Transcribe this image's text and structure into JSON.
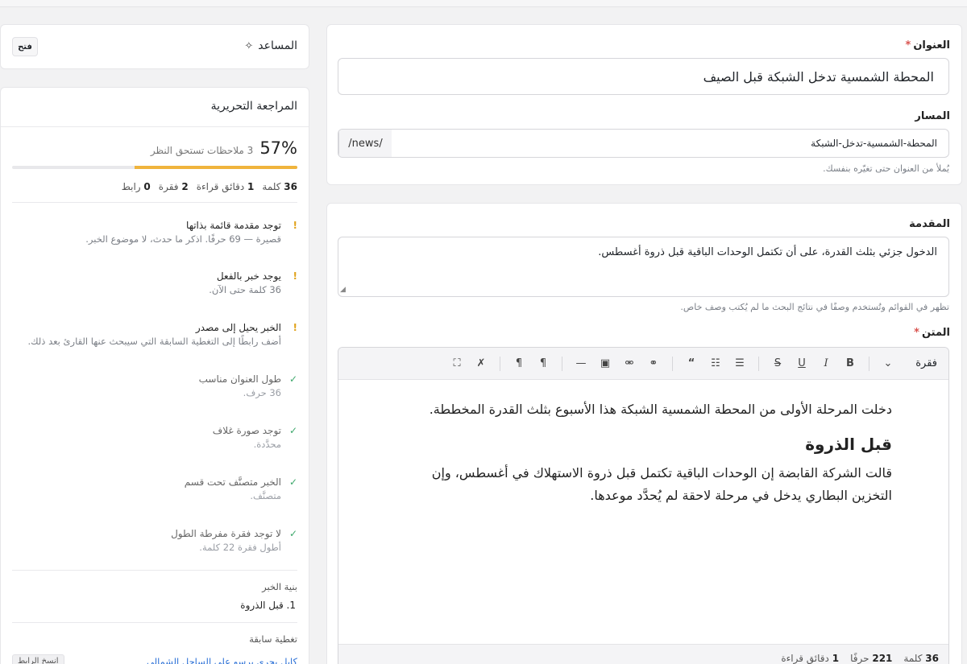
{
  "form": {
    "title_label": "العنوان",
    "title_required": "*",
    "title_value": "المحطة الشمسية تدخل الشبكة قبل الصيف",
    "slug_label": "المسار",
    "slug_prefix": "/news/",
    "slug_value": "المحطة-الشمسية-تدخل-الشبكة",
    "slug_hint": "يُملأ من العنوان حتى تغيّره بنفسك.",
    "lead_label": "المقدمة",
    "lead_value": "الدخول جزئي بثلث القدرة، على أن تكتمل الوحدات الباقية قبل ذروة أغسطس.",
    "lead_hint": "تظهر في القوائم وتُستخدم وصفًا في نتائج البحث ما لم يُكتب وصف خاص.",
    "body_label": "المتن",
    "body_required": "*"
  },
  "editor": {
    "block_type": "فقرة",
    "paragraph_1": "دخلت المرحلة الأولى من المحطة الشمسية الشبكة هذا الأسبوع بثلث القدرة المخططة.",
    "heading": "قبل الذروة",
    "paragraph_2": "قالت الشركة القابضة إن الوحدات الباقية تكتمل قبل ذروة الاستهلاك في أغسطس، وإن التخزين البطاري يدخل في مرحلة لاحقة لم يُحدَّد موعدها.",
    "footer": {
      "words_num": "36",
      "words_label": "كلمة",
      "chars_num": "221",
      "chars_label": "حرفًا",
      "read_num": "1",
      "read_label": "دقائق قراءة"
    },
    "toolbar_icons": [
      "chevron-down-icon",
      "bold-icon",
      "italic-icon",
      "underline-icon",
      "strikethrough-icon",
      "bullet-list-icon",
      "ordered-list-icon",
      "quote-icon",
      "link-icon",
      "unlink-icon",
      "image-icon",
      "horizontal-rule-icon",
      "rtl-icon",
      "ltr-icon",
      "clear-format-icon",
      "fullscreen-icon"
    ]
  },
  "assistant": {
    "title": "المساعد",
    "open_label": "فتح"
  },
  "review": {
    "title": "المراجعة التحريرية",
    "score": "57%",
    "score_value": 0.57,
    "notes": "3 ملاحظات تستحق النظر",
    "stats": {
      "words_num": "36",
      "words_label": "كلمة",
      "read_num": "1",
      "read_label": "دقائق قراءة",
      "paras_num": "2",
      "paras_label": "فقرة",
      "links_num": "0",
      "links_label": "رابط"
    },
    "checks": [
      {
        "status": "warn",
        "mark": "!",
        "title": "توجد مقدمة قائمة بذاتها",
        "detail": "قصيرة — 69 حرفًا. اذكر ما حدث، لا موضوع الخبر."
      },
      {
        "status": "warn",
        "mark": "!",
        "title": "يوجد خبر بالفعل",
        "detail": "36 كلمة حتى الآن."
      },
      {
        "status": "warn",
        "mark": "!",
        "title": "الخبر يحيل إلى مصدر",
        "detail": "أضف رابطًا إلى التغطية السابقة التي سيبحث عنها القارئ بعد ذلك."
      },
      {
        "status": "ok",
        "mark": "✓",
        "title": "طول العنوان مناسب",
        "detail": "36 حرف."
      },
      {
        "status": "ok",
        "mark": "✓",
        "title": "توجد صورة غلاف",
        "detail": "محدَّدة."
      },
      {
        "status": "ok",
        "mark": "✓",
        "title": "الخبر متصنَّف تحت قسم",
        "detail": "متصنَّف."
      },
      {
        "status": "ok",
        "mark": "✓",
        "title": "لا توجد فقرة مفرطة الطول",
        "detail": "أطول فقرة 22 كلمة."
      }
    ],
    "outline_label": "بنية الخبر",
    "outline_item": "1. قبل الذروة",
    "previous_label": "تغطية سابقة",
    "previous_link": "كابل بحري يرسو على الساحل الشمالي",
    "copy_link_label": "انسخ الرابط"
  },
  "colors": {
    "accent_warn": "#f0b43c",
    "ok": "#3ea86c",
    "link": "#2a6fd6",
    "required": "#d9534f"
  }
}
